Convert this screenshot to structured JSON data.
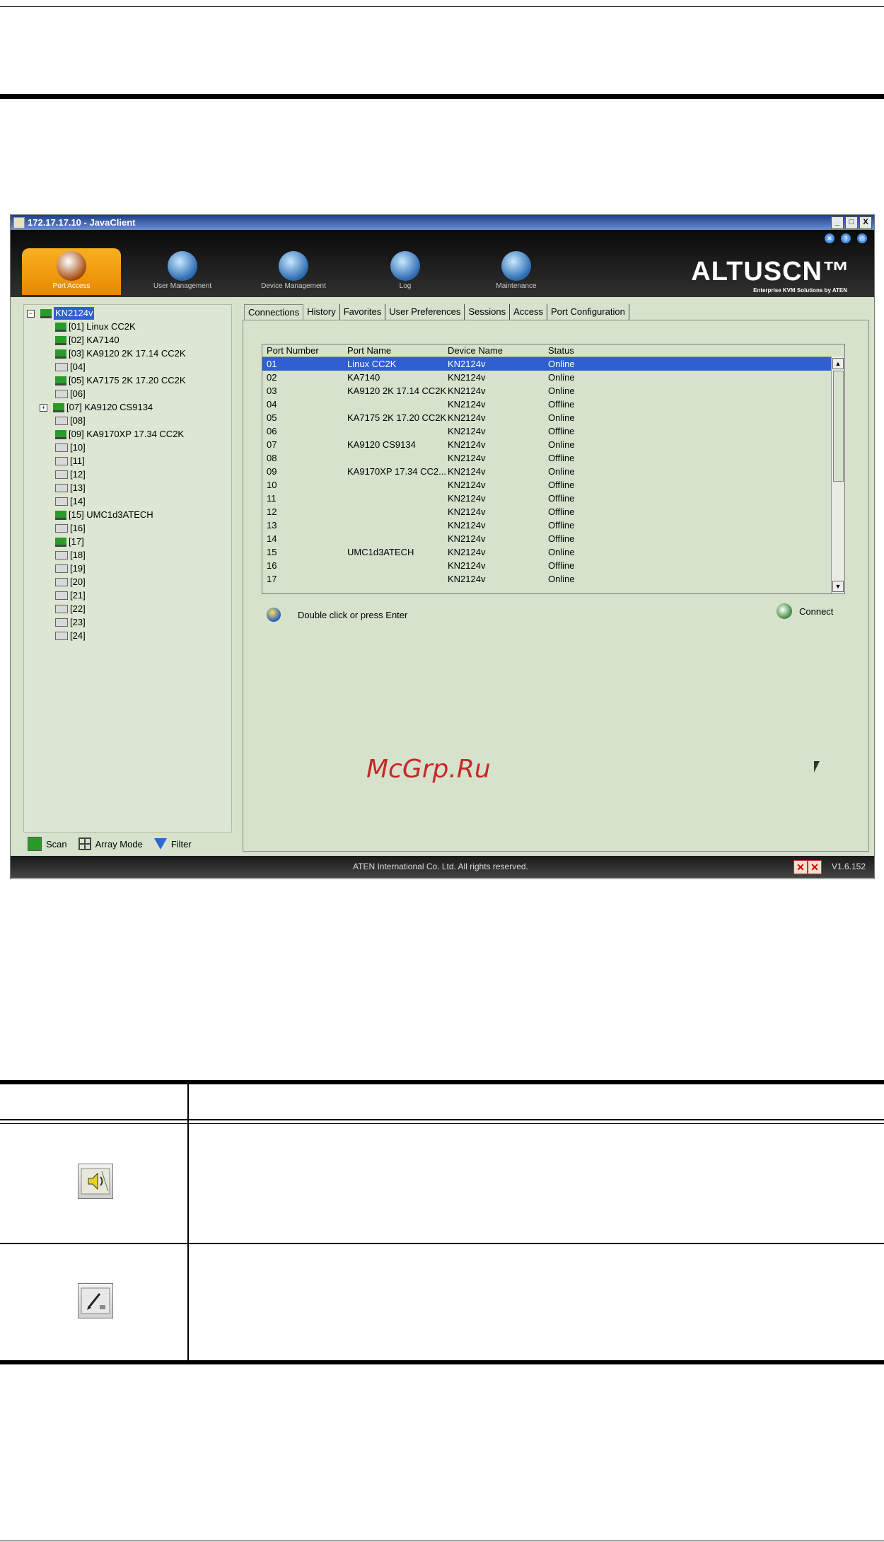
{
  "window": {
    "title": "172.17.17.10 - JavaClient",
    "buttons": [
      "_",
      "□",
      "X"
    ]
  },
  "nav": [
    {
      "label": "Port Access",
      "active": true
    },
    {
      "label": "User Management",
      "active": false
    },
    {
      "label": "Device Management",
      "active": false
    },
    {
      "label": "Log",
      "active": false
    },
    {
      "label": "Maintenance",
      "active": false
    }
  ],
  "brand": {
    "logo": "ALTUSCN™",
    "tagline": "Enterprise KVM Solutions by ATEN"
  },
  "tree": {
    "root": "KN2124v",
    "items": [
      "[01] Linux CC2K",
      "[02] KA7140",
      "[03] KA9120 2K 17.14 CC2K",
      "[04]",
      "[05] KA7175 2K 17.20 CC2K",
      "[06]",
      "[07] KA9120 CS9134",
      "[08]",
      "[09] KA9170XP 17.34 CC2K",
      "[10]",
      "[11]",
      "[12]",
      "[13]",
      "[14]",
      "[15] UMC1d3ATECH",
      "[16]",
      "[17]",
      "[18]",
      "[19]",
      "[20]",
      "[21]",
      "[22]",
      "[23]",
      "[24]"
    ],
    "footer": {
      "scan": "Scan",
      "array_mode": "Array Mode",
      "filter": "Filter"
    }
  },
  "tabs": [
    "Connections",
    "History",
    "Favorites",
    "User Preferences",
    "Sessions",
    "Access",
    "Port Configuration"
  ],
  "grid": {
    "columns": [
      "Port Number",
      "Port Name",
      "Device Name",
      "Status"
    ],
    "rows": [
      [
        "01",
        "Linux CC2K",
        "KN2124v",
        "Online"
      ],
      [
        "02",
        "KA7140",
        "KN2124v",
        "Online"
      ],
      [
        "03",
        "KA9120 2K 17.14 CC2K",
        "KN2124v",
        "Online"
      ],
      [
        "04",
        "",
        "KN2124v",
        "Offline"
      ],
      [
        "05",
        "KA7175 2K 17.20 CC2K",
        "KN2124v",
        "Online"
      ],
      [
        "06",
        "",
        "KN2124v",
        "Offline"
      ],
      [
        "07",
        "KA9120 CS9134",
        "KN2124v",
        "Online"
      ],
      [
        "08",
        "",
        "KN2124v",
        "Offline"
      ],
      [
        "09",
        "KA9170XP 17.34 CC2...",
        "KN2124v",
        "Online"
      ],
      [
        "10",
        "",
        "KN2124v",
        "Offline"
      ],
      [
        "11",
        "",
        "KN2124v",
        "Offline"
      ],
      [
        "12",
        "",
        "KN2124v",
        "Offline"
      ],
      [
        "13",
        "",
        "KN2124v",
        "Offline"
      ],
      [
        "14",
        "",
        "KN2124v",
        "Offline"
      ],
      [
        "15",
        "UMC1d3ATECH",
        "KN2124v",
        "Online"
      ],
      [
        "16",
        "",
        "KN2124v",
        "Offline"
      ],
      [
        "17",
        "",
        "KN2124v",
        "Online"
      ]
    ]
  },
  "hint": "Double click or press Enter",
  "connect": "Connect",
  "status": {
    "copyright": "ATEN International Co. Ltd. All rights reserved.",
    "version": "V1.6.152"
  },
  "watermark": "McGrp.Ru"
}
